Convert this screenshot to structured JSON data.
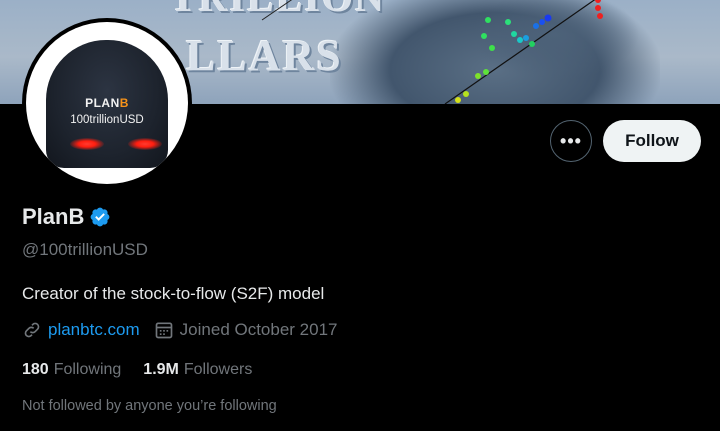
{
  "banner": {
    "text_line1": "TRILLION",
    "text_line2": "LLARS"
  },
  "avatar": {
    "cap_brand": "PLAN",
    "cap_brand_b": "B",
    "cap_handle": "100trillionUSD"
  },
  "actions": {
    "more_label": "•••",
    "follow_label": "Follow"
  },
  "profile": {
    "name": "PlanB",
    "handle": "@100trillionUSD",
    "bio": "Creator of the stock-to-flow (S2F) model",
    "website": "planbtc.com",
    "joined": "Joined October 2017"
  },
  "stats": {
    "following_count": "180",
    "following_label": "Following",
    "followers_count": "1.9M",
    "followers_label": "Followers"
  },
  "social_context": "Not followed by anyone you’re following",
  "colors": {
    "accent": "#1d9bf0",
    "background": "#000000",
    "muted_text": "#71767b",
    "follow_button_bg": "#eff3f4"
  },
  "icons": {
    "verified": "verified-badge-icon",
    "link": "link-icon",
    "calendar": "calendar-icon",
    "more": "more-dots-icon"
  }
}
